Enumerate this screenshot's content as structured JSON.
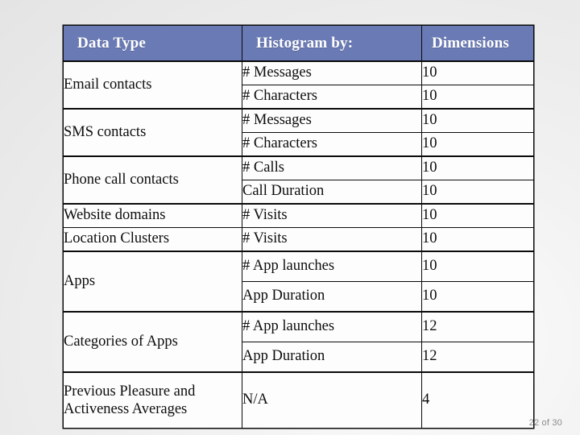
{
  "table": {
    "headers": {
      "data_type": "Data Type",
      "histogram_by": "Histogram by:",
      "dimensions": "Dimensions"
    },
    "rows": [
      {
        "data_type": "Email contacts",
        "entries": [
          {
            "histogram_by": "# Messages",
            "dimensions": "10"
          },
          {
            "histogram_by": "# Characters",
            "dimensions": "10"
          }
        ]
      },
      {
        "data_type": "SMS contacts",
        "entries": [
          {
            "histogram_by": "# Messages",
            "dimensions": "10"
          },
          {
            "histogram_by": "# Characters",
            "dimensions": "10"
          }
        ]
      },
      {
        "data_type": "Phone call contacts",
        "entries": [
          {
            "histogram_by": "# Calls",
            "dimensions": "10"
          },
          {
            "histogram_by": "Call Duration",
            "dimensions": "10"
          }
        ]
      },
      {
        "data_type": "Website domains",
        "entries": [
          {
            "histogram_by": "# Visits",
            "dimensions": "10"
          }
        ]
      },
      {
        "data_type": "Location Clusters",
        "entries": [
          {
            "histogram_by": "# Visits",
            "dimensions": "10"
          }
        ]
      },
      {
        "data_type": "Apps",
        "entries": [
          {
            "histogram_by": "# App launches",
            "dimensions": "10"
          },
          {
            "histogram_by": "App Duration",
            "dimensions": "10"
          }
        ]
      },
      {
        "data_type": "Categories of Apps",
        "entries": [
          {
            "histogram_by": "# App launches",
            "dimensions": "12"
          },
          {
            "histogram_by": "App Duration",
            "dimensions": "12"
          }
        ]
      },
      {
        "data_type_line1": "Previous Pleasure and",
        "data_type_line2": "Activeness Averages",
        "entries": [
          {
            "histogram_by": "N/A",
            "dimensions": "4"
          }
        ]
      }
    ]
  },
  "footer": {
    "page_label": "22 of 30"
  },
  "colors": {
    "header_background": "#6a7ab4",
    "header_text": "#ffffff",
    "cell_background": "#fdfdfd",
    "border": "#0a0a0a",
    "page_number_text": "#8c8c8c"
  }
}
